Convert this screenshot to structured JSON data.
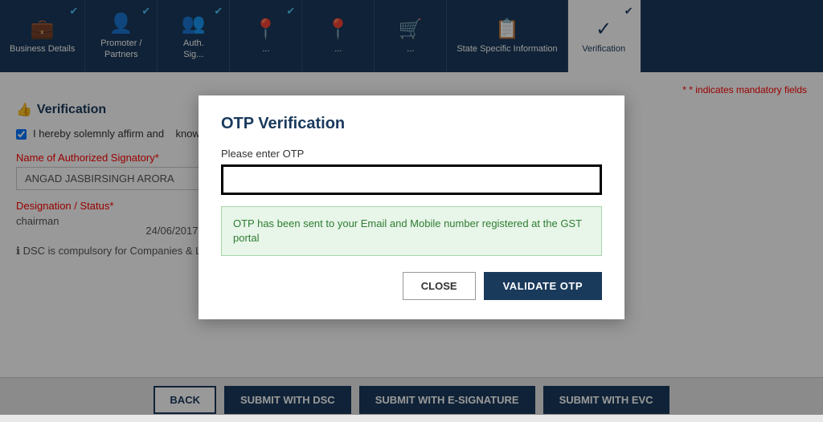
{
  "nav": {
    "items": [
      {
        "id": "business-details",
        "label": "Business\nDetails",
        "icon": "💼",
        "checked": true,
        "active": false
      },
      {
        "id": "promoter-partners",
        "label": "Promoter /\nPartners",
        "icon": "👤",
        "checked": true,
        "active": false
      },
      {
        "id": "authorized-signatory",
        "label": "Auth.\nSig...",
        "icon": "👥",
        "checked": true,
        "active": false
      },
      {
        "id": "principal-place",
        "label": "...",
        "icon": "📍",
        "checked": true,
        "active": false
      },
      {
        "id": "additional-place",
        "label": "...",
        "icon": "📍",
        "checked": false,
        "active": false
      },
      {
        "id": "goods-services",
        "label": "...",
        "icon": "🛒",
        "checked": false,
        "active": false
      },
      {
        "id": "state-specific",
        "label": "State Specific\nInformation",
        "icon": "📋",
        "checked": false,
        "active": false
      },
      {
        "id": "verification",
        "label": "Verification",
        "icon": "✓",
        "checked": true,
        "active": true
      }
    ]
  },
  "page": {
    "mandatory_note": "* indicates mandatory fields",
    "section_title": "Verification",
    "affirmation_text": "I hereby solemnly affirm and declare that the information given herein above is true and correct to the best of my knowledge and belief and nothing has been concealed therefrom",
    "authorized_signatory_label": "Name of Authorized Signatory",
    "authorized_signatory_required": "*",
    "authorized_signatory_value": "ANGAD JASBIRSINGH ARORA",
    "designation_label": "Designation / Status",
    "designation_required": "*",
    "designation_value": "chairman",
    "date_value": "24/06/2017",
    "dsc_note": "DSC is compulsory for Companies & LLP"
  },
  "bottom_bar": {
    "back_label": "BACK",
    "submit_dsc_label": "SUBMIT WITH DSC",
    "submit_esig_label": "SUBMIT WITH E-SIGNATURE",
    "submit_evc_label": "SUBMIT WITH EVC"
  },
  "modal": {
    "title": "OTP Verification",
    "label": "Please enter OTP",
    "otp_placeholder": "",
    "info_message": "OTP has been sent to your Email and Mobile number registered at the GST portal",
    "close_label": "CLOSE",
    "validate_label": "VALIDATE OTP"
  }
}
